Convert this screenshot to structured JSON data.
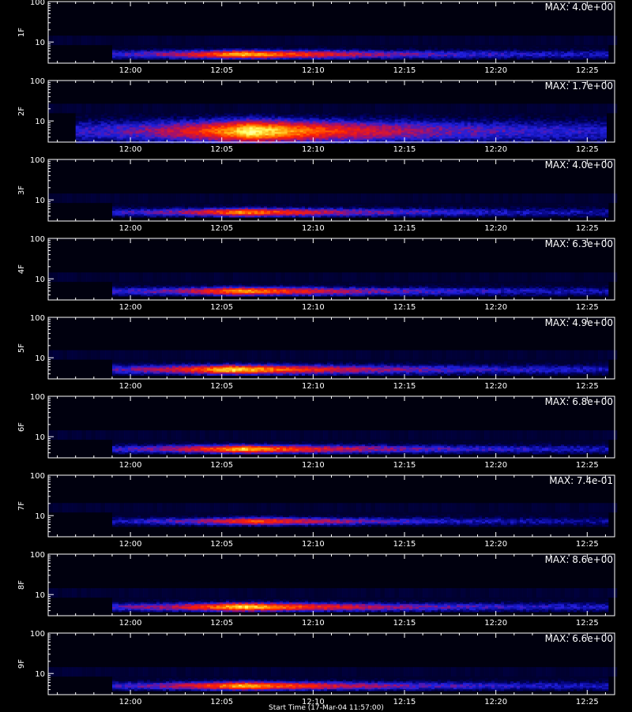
{
  "figure": {
    "bottom_title": "Start Time (17-Mar-04 11:57:00)"
  },
  "colors": {
    "background": "#000000",
    "axis": "#ffffff",
    "colormap": [
      "#000010",
      "#00006a",
      "#2020e0",
      "#b01060",
      "#ff2000",
      "#ff9a00",
      "#ffff60",
      "#ffffe0"
    ]
  },
  "chart_data": [
    {
      "type": "heatmap",
      "panel_label": "1F",
      "max_label": "MAX: 4.0e+00",
      "x_tick_labels": [
        "12:00",
        "12:05",
        "12:10",
        "12:15",
        "12:20",
        "12:25"
      ],
      "y_tick_labels": [
        "10",
        "100"
      ],
      "y_scale": "log",
      "ylim": [
        3,
        100
      ],
      "data_start": "11:59:00",
      "data_end": "12:26:00",
      "peak_time": "12:06:00",
      "band_y": [
        4,
        7
      ],
      "intensity": 0.8
    },
    {
      "type": "heatmap",
      "panel_label": "2F",
      "max_label": "MAX: 1.7e+00",
      "x_tick_labels": [
        "12:00",
        "12:05",
        "12:10",
        "12:15",
        "12:20",
        "12:25"
      ],
      "y_tick_labels": [
        "10",
        "100"
      ],
      "y_scale": "log",
      "ylim": [
        3,
        100
      ],
      "data_start": "11:57:00",
      "data_end": "12:26:00",
      "peak_time": "12:06:30",
      "band_y": [
        3,
        13
      ],
      "intensity": 0.9
    },
    {
      "type": "heatmap",
      "panel_label": "3F",
      "max_label": "MAX: 4.0e+00",
      "x_tick_labels": [
        "12:00",
        "12:05",
        "12:10",
        "12:15",
        "12:20",
        "12:25"
      ],
      "y_tick_labels": [
        "10",
        "100"
      ],
      "y_scale": "log",
      "ylim": [
        3,
        100
      ],
      "data_start": "11:59:00",
      "data_end": "12:26:00",
      "peak_time": "12:06:00",
      "band_y": [
        4,
        7
      ],
      "intensity": 0.72
    },
    {
      "type": "heatmap",
      "panel_label": "4F",
      "max_label": "MAX: 6.3e+00",
      "x_tick_labels": [
        "12:00",
        "12:05",
        "12:10",
        "12:15",
        "12:20",
        "12:25"
      ],
      "y_tick_labels": [
        "10",
        "100"
      ],
      "y_scale": "log",
      "ylim": [
        3,
        100
      ],
      "data_start": "11:59:00",
      "data_end": "12:26:00",
      "peak_time": "12:06:00",
      "band_y": [
        4,
        7
      ],
      "intensity": 0.75
    },
    {
      "type": "heatmap",
      "panel_label": "5F",
      "max_label": "MAX: 4.9e+00",
      "x_tick_labels": [
        "12:00",
        "12:05",
        "12:10",
        "12:15",
        "12:20",
        "12:25"
      ],
      "y_tick_labels": [
        "10",
        "100"
      ],
      "y_scale": "log",
      "ylim": [
        3,
        100
      ],
      "data_start": "11:59:00",
      "data_end": "12:26:00",
      "peak_time": "12:05:30",
      "band_y": [
        4,
        7.5
      ],
      "intensity": 0.85
    },
    {
      "type": "heatmap",
      "panel_label": "6F",
      "max_label": "MAX: 6.8e+00",
      "x_tick_labels": [
        "12:00",
        "12:05",
        "12:10",
        "12:15",
        "12:20",
        "12:25"
      ],
      "y_tick_labels": [
        "10",
        "100"
      ],
      "y_scale": "log",
      "ylim": [
        3,
        100
      ],
      "data_start": "11:59:00",
      "data_end": "12:26:00",
      "peak_time": "12:06:00",
      "band_y": [
        4,
        7
      ],
      "intensity": 0.8
    },
    {
      "type": "heatmap",
      "panel_label": "7F",
      "max_label": "MAX: 7.4e-01",
      "x_tick_labels": [
        "12:00",
        "12:05",
        "12:10",
        "12:15",
        "12:20",
        "12:25"
      ],
      "y_tick_labels": [
        "10",
        "100"
      ],
      "y_scale": "log",
      "ylim": [
        3,
        100
      ],
      "data_start": "11:59:00",
      "data_end": "12:26:00",
      "peak_time": "12:06:30",
      "band_y": [
        6,
        10
      ],
      "intensity": 0.65
    },
    {
      "type": "heatmap",
      "panel_label": "8F",
      "max_label": "MAX: 8.6e+00",
      "x_tick_labels": [
        "12:00",
        "12:05",
        "12:10",
        "12:15",
        "12:20",
        "12:25"
      ],
      "y_tick_labels": [
        "10",
        "100"
      ],
      "y_scale": "log",
      "ylim": [
        3,
        100
      ],
      "data_start": "11:59:00",
      "data_end": "12:26:00",
      "peak_time": "12:06:00",
      "band_y": [
        4,
        7
      ],
      "intensity": 0.85
    },
    {
      "type": "heatmap",
      "panel_label": "9F",
      "max_label": "MAX: 6.6e+00",
      "x_tick_labels": [
        "12:00",
        "12:05",
        "12:10",
        "12:15",
        "12:20",
        "12:25"
      ],
      "y_tick_labels": [
        "10",
        "100"
      ],
      "y_scale": "log",
      "ylim": [
        3,
        100
      ],
      "data_start": "11:59:00",
      "data_end": "12:26:00",
      "peak_time": "12:06:00",
      "band_y": [
        4,
        7
      ],
      "intensity": 0.8
    }
  ]
}
